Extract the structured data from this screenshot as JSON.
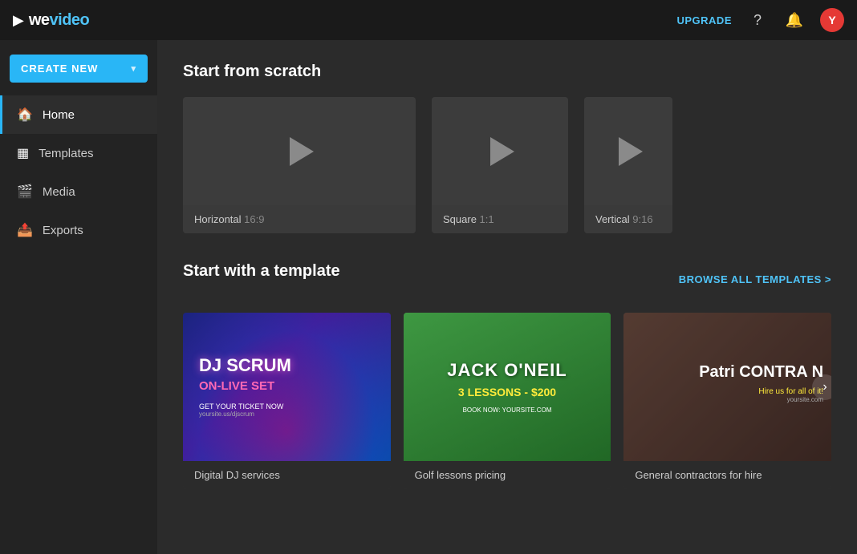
{
  "header": {
    "logo_text_we": "we",
    "logo_text_video": "video",
    "upgrade_label": "UPGRADE",
    "avatar_letter": "Y"
  },
  "sidebar": {
    "create_btn_label": "CREATE NEW",
    "create_btn_chevron": "▾",
    "nav_items": [
      {
        "id": "home",
        "label": "Home",
        "icon": "🏠",
        "active": true
      },
      {
        "id": "templates",
        "label": "Templates",
        "icon": "▦",
        "active": false
      },
      {
        "id": "media",
        "label": "Media",
        "icon": "🎬",
        "active": false
      },
      {
        "id": "exports",
        "label": "Exports",
        "icon": "📤",
        "active": false
      }
    ]
  },
  "main": {
    "scratch_section_title": "Start from scratch",
    "scratch_cards": [
      {
        "id": "horizontal",
        "label": "Horizontal",
        "aspect": "16:9"
      },
      {
        "id": "square",
        "label": "Square",
        "aspect": "1:1"
      },
      {
        "id": "vertical",
        "label": "Vertical",
        "aspect": "9:16"
      }
    ],
    "template_section_title": "Start with a template",
    "browse_all_label": "BROWSE ALL TEMPLATES >",
    "template_cards": [
      {
        "id": "dj",
        "label": "Digital DJ services",
        "dj_name": "DJ SCRUM",
        "dj_subtitle": "ON-LIVE SET",
        "dj_cta": "GET YOUR TICKET NOW",
        "dj_site": "yoursite.us/djscrum"
      },
      {
        "id": "golf",
        "label": "Golf lessons pricing",
        "golf_title": "JACK O'NEIL",
        "golf_subtitle": "3 LESSONS - $200",
        "golf_cta": "BOOK NOW: YOURSITE.COM"
      },
      {
        "id": "contractor",
        "label": "General contractors for hire",
        "contractor_name": "Patri CONTRA N",
        "contractor_cta": "Hire us for all of it!",
        "contractor_site": "yoursite.com"
      }
    ]
  }
}
